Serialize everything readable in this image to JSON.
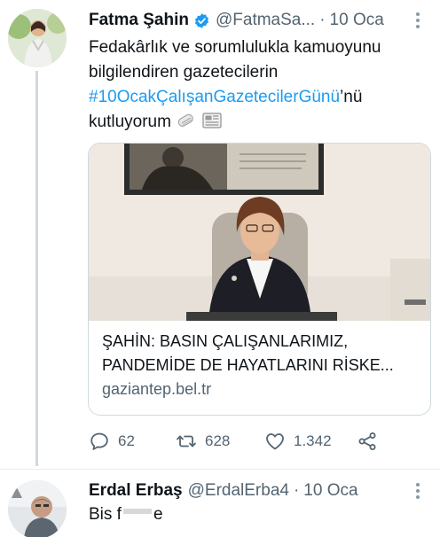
{
  "main_tweet": {
    "author_name": "Fatma Şahin",
    "handle": "@FatmaSa...",
    "separator": "·",
    "time": "10 Oca",
    "text_line1": "Fedakârlık ve sorumlulukla kamuoyunu",
    "text_line2": "bilgilendiren gazetecilerin",
    "hashtag": "#10OcakÇalışanGazetecilerGünü",
    "hashtag_suffix": "’nü",
    "text_line4": "kutluyorum",
    "emojis": [
      "newspaper-roll-icon",
      "newspaper-icon"
    ],
    "card": {
      "title_line1": "ŞAHİN: BASIN ÇALIŞANLARIMIZ,",
      "title_line2": "PANDEMİDE DE HAYATLARINI RİSKE...",
      "domain": "gaziantep.bel.tr"
    },
    "actions": {
      "replies": "62",
      "retweets": "628",
      "likes": "1.342"
    }
  },
  "reply_tweet": {
    "author_name": "Erdal Erbaş",
    "handle": "@ErdalErba4",
    "separator": "·",
    "time": "10 Oca",
    "text_start": "Bis f",
    "text_end": "e"
  },
  "colors": {
    "link": "#1d9bf0",
    "verified": "#1d9bf0",
    "secondary_text": "#536471",
    "border": "#cfd9de"
  }
}
